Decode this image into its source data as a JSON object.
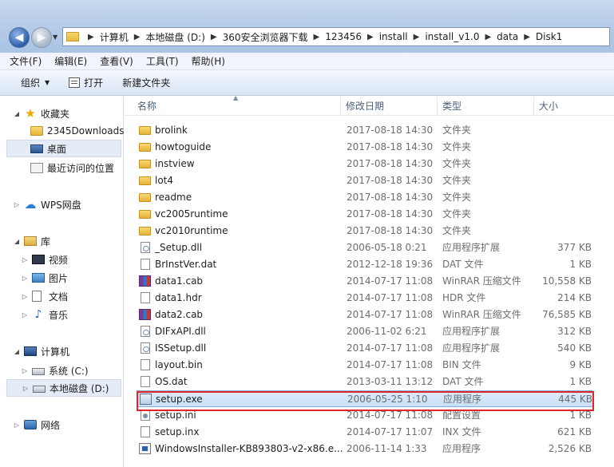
{
  "nav": {
    "back_label": "◀",
    "forward_label": "▶"
  },
  "address": {
    "crumbs": [
      "计算机",
      "本地磁盘 (D:)",
      "360安全浏览器下载",
      "123456",
      "install",
      "install_v1.0",
      "data",
      "Disk1"
    ]
  },
  "menu": [
    "文件(F)",
    "编辑(E)",
    "查看(V)",
    "工具(T)",
    "帮助(H)"
  ],
  "toolbar": {
    "organize": "组织",
    "open": "打开",
    "new_folder": "新建文件夹"
  },
  "sidebar": {
    "favorites": "收藏夹",
    "fav_items": [
      "2345Downloads",
      "桌面",
      "最近访问的位置"
    ],
    "wps": "WPS网盘",
    "libraries": "库",
    "lib_items": [
      "视频",
      "图片",
      "文档",
      "音乐"
    ],
    "computer": "计算机",
    "drives": [
      "系统 (C:)",
      "本地磁盘 (D:)"
    ],
    "network": "网络"
  },
  "columns": {
    "name": "名称",
    "date": "修改日期",
    "type": "类型",
    "size": "大小"
  },
  "files": [
    {
      "name": "brolink",
      "date": "2017-08-18 14:30",
      "type": "文件夹",
      "size": "",
      "icon": "folder"
    },
    {
      "name": "howtoguide",
      "date": "2017-08-18 14:30",
      "type": "文件夹",
      "size": "",
      "icon": "folder"
    },
    {
      "name": "instview",
      "date": "2017-08-18 14:30",
      "type": "文件夹",
      "size": "",
      "icon": "folder"
    },
    {
      "name": "lot4",
      "date": "2017-08-18 14:30",
      "type": "文件夹",
      "size": "",
      "icon": "folder"
    },
    {
      "name": "readme",
      "date": "2017-08-18 14:30",
      "type": "文件夹",
      "size": "",
      "icon": "folder"
    },
    {
      "name": "vc2005runtime",
      "date": "2017-08-18 14:30",
      "type": "文件夹",
      "size": "",
      "icon": "folder"
    },
    {
      "name": "vc2010runtime",
      "date": "2017-08-18 14:30",
      "type": "文件夹",
      "size": "",
      "icon": "folder"
    },
    {
      "name": "_Setup.dll",
      "date": "2006-05-18 0:21",
      "type": "应用程序扩展",
      "size": "377 KB",
      "icon": "dll"
    },
    {
      "name": "BrInstVer.dat",
      "date": "2012-12-18 19:36",
      "type": "DAT 文件",
      "size": "1 KB",
      "icon": "generic"
    },
    {
      "name": "data1.cab",
      "date": "2014-07-17 11:08",
      "type": "WinRAR 压缩文件",
      "size": "10,558 KB",
      "icon": "rar"
    },
    {
      "name": "data1.hdr",
      "date": "2014-07-17 11:08",
      "type": "HDR 文件",
      "size": "214 KB",
      "icon": "generic"
    },
    {
      "name": "data2.cab",
      "date": "2014-07-17 11:08",
      "type": "WinRAR 压缩文件",
      "size": "76,585 KB",
      "icon": "rar"
    },
    {
      "name": "DIFxAPI.dll",
      "date": "2006-11-02 6:21",
      "type": "应用程序扩展",
      "size": "312 KB",
      "icon": "dll"
    },
    {
      "name": "ISSetup.dll",
      "date": "2014-07-17 11:08",
      "type": "应用程序扩展",
      "size": "540 KB",
      "icon": "dll"
    },
    {
      "name": "layout.bin",
      "date": "2014-07-17 11:08",
      "type": "BIN 文件",
      "size": "9 KB",
      "icon": "generic"
    },
    {
      "name": "OS.dat",
      "date": "2013-03-11 13:12",
      "type": "DAT 文件",
      "size": "1 KB",
      "icon": "generic"
    },
    {
      "name": "setup.exe",
      "date": "2006-05-25 1:10",
      "type": "应用程序",
      "size": "445 KB",
      "icon": "exe",
      "selected": true
    },
    {
      "name": "setup.ini",
      "date": "2014-07-17 11:08",
      "type": "配置设置",
      "size": "1 KB",
      "icon": "ini"
    },
    {
      "name": "setup.inx",
      "date": "2014-07-17 11:07",
      "type": "INX 文件",
      "size": "621 KB",
      "icon": "generic"
    },
    {
      "name": "WindowsInstaller-KB893803-v2-x86.e...",
      "date": "2006-11-14 1:33",
      "type": "应用程序",
      "size": "2,526 KB",
      "icon": "msu"
    }
  ]
}
